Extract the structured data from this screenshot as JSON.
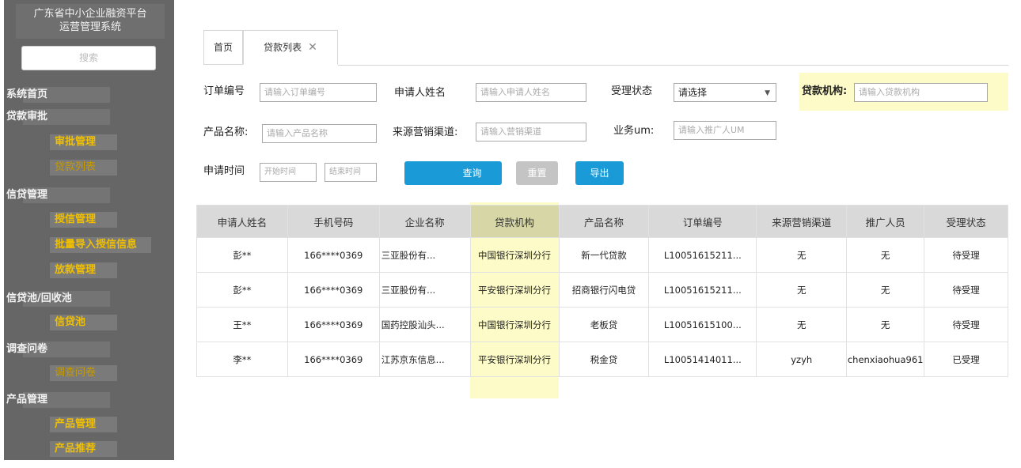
{
  "sidebar": {
    "app_title_line1": "广东省中小企业融资平台",
    "app_title_line2": "运营管理系统",
    "search_placeholder": "搜索",
    "sections": [
      {
        "label": "系统首页",
        "items": []
      },
      {
        "label": "贷款审批",
        "items": [
          "审批管理",
          "贷款列表"
        ]
      },
      {
        "label": "信贷管理",
        "items": [
          "授信管理",
          "批量导入授信信息",
          "放款管理"
        ]
      },
      {
        "label": "信贷池/回收池",
        "items": [
          "信贷池"
        ]
      },
      {
        "label": "调查问卷",
        "items": [
          "调查问卷"
        ]
      },
      {
        "label": "产品管理",
        "items": [
          "产品管理",
          "产品推荐"
        ]
      }
    ],
    "active_item": "贷款列表"
  },
  "tabs": {
    "home": "首页",
    "loans": "贷款列表",
    "close": "✕"
  },
  "filters": {
    "order_no_label": "订单编号",
    "order_no_placeholder": "请输入订单编号",
    "applicant_label": "申请人姓名",
    "applicant_placeholder": "请输入申请人姓名",
    "status_label": "受理状态",
    "status_value": "请选择",
    "org_label": "贷款机构:",
    "org_placeholder": "请输入贷款机构",
    "product_label": "产品名称:",
    "product_placeholder": "请输入产品名称",
    "channel_label": "来源营销渠道:",
    "channel_placeholder": "请输入营销渠道",
    "um_label": "业务um:",
    "um_placeholder": "请输入推广人UM",
    "time_label": "申请时间",
    "start_placeholder": "开始时间",
    "end_placeholder": "结束时间"
  },
  "buttons": {
    "query": "查询",
    "reset": "重置",
    "export": "导出"
  },
  "table": {
    "headers": [
      "申请人姓名",
      "手机号码",
      "企业名称",
      "贷款机构",
      "产品名称",
      "订单编号",
      "来源营销渠道",
      "推广人员",
      "受理状态"
    ],
    "rows": [
      [
        "彭**",
        "166****0369",
        "三亚股份有...",
        "中国银行深圳分行",
        "新一代贷款",
        "L10051615211...",
        "无",
        "无",
        "待受理"
      ],
      [
        "彭**",
        "166****0369",
        "三亚股份有...",
        "平安银行深圳分行",
        "招商银行闪电贷",
        "L10051615211...",
        "无",
        "无",
        "待受理"
      ],
      [
        "王**",
        "166****0369",
        "国药控股汕头...",
        "中国银行深圳分行",
        "老板贷",
        "L10051615100...",
        "无",
        "无",
        "待受理"
      ],
      [
        "李**",
        "166****0369",
        "江苏京东信息...",
        "平安银行深圳分行",
        "税金贷",
        "L10051414011...",
        "yzyh",
        "chenxiaohua961",
        "已受理"
      ]
    ]
  },
  "colors": {
    "sidebar_bg": "#666666",
    "menu_item_text": "#f0c000",
    "highlight": "#fdfcc8",
    "primary_button": "#1a9ad6",
    "reset_button": "#c4c4c4",
    "table_header_bg": "#d9d9d9"
  }
}
